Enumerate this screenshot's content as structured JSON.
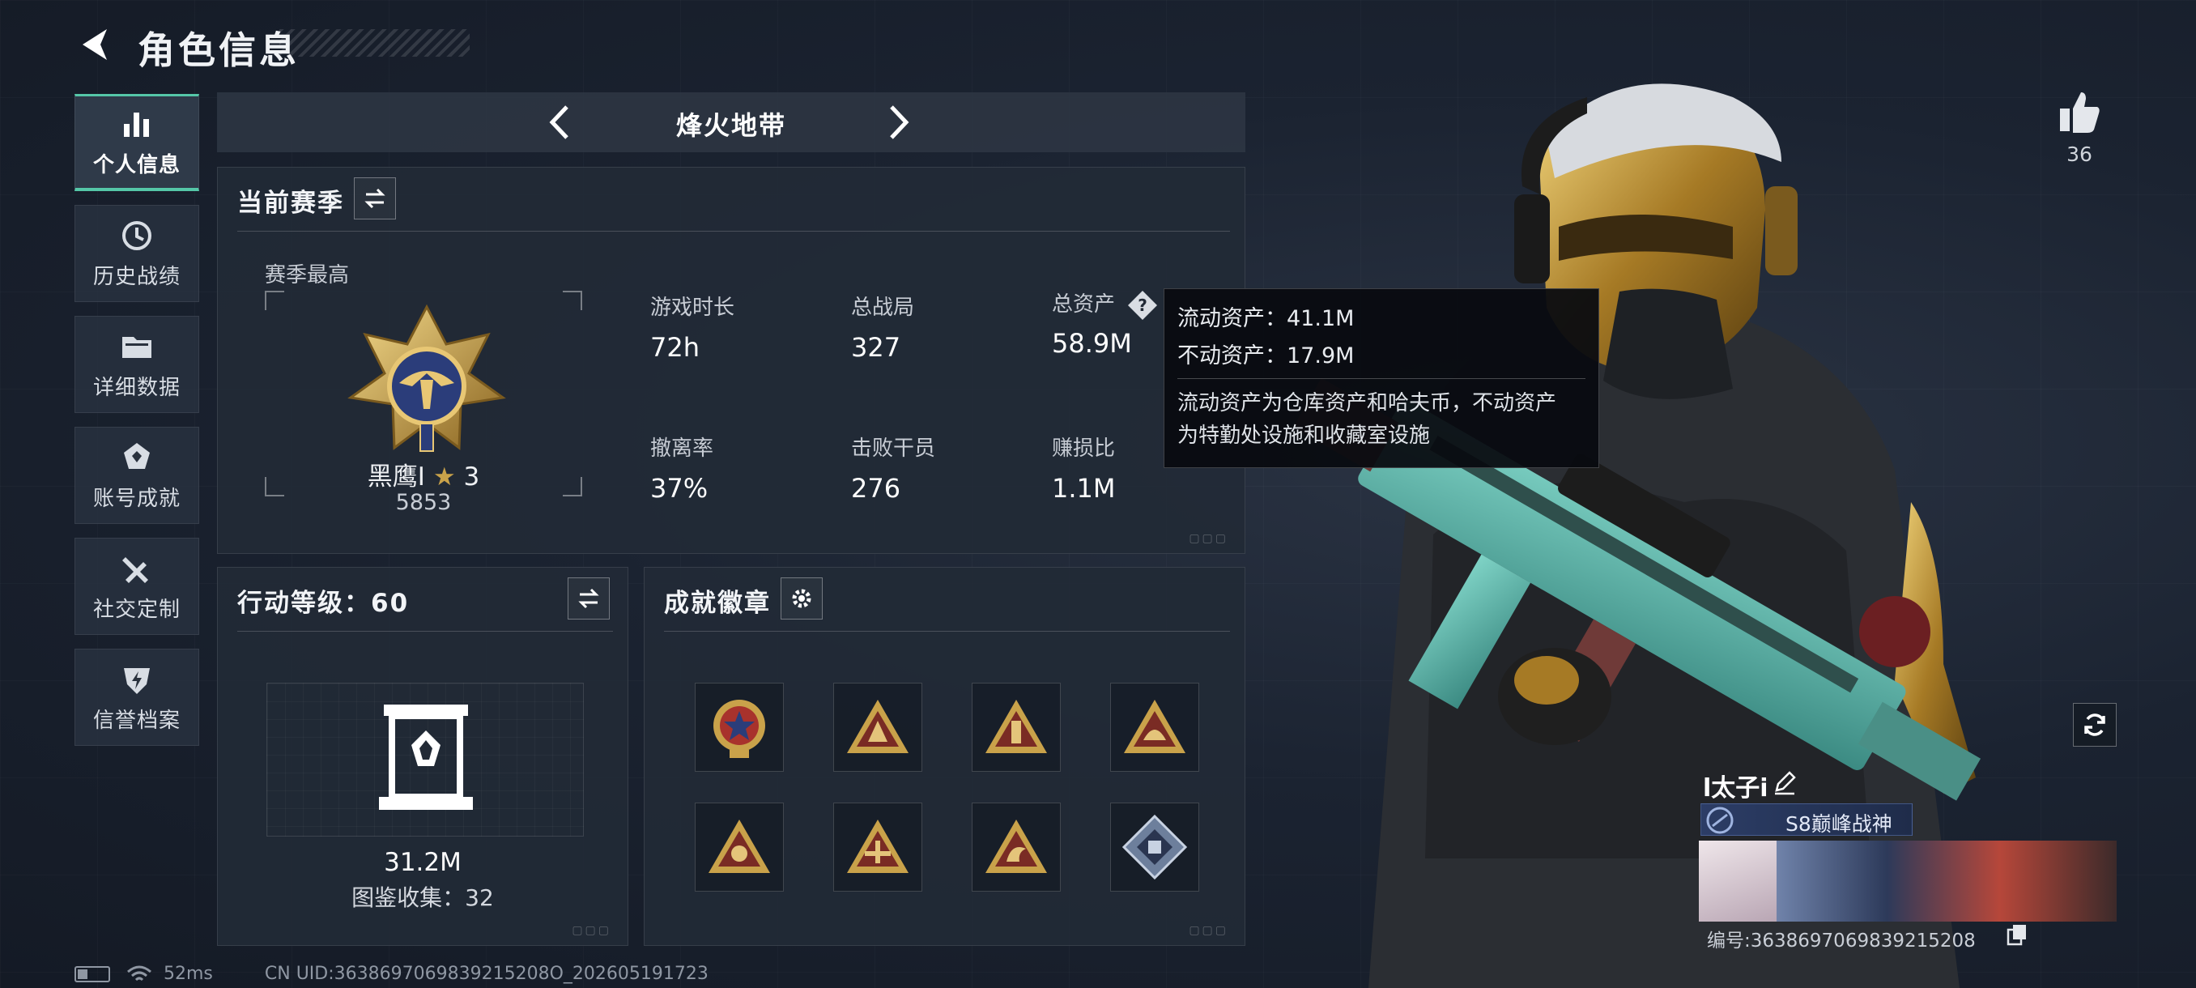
{
  "header": {
    "title": "角色信息"
  },
  "sidebar": {
    "items": [
      {
        "label": "个人信息",
        "icon": "bar-chart-icon"
      },
      {
        "label": "历史战绩",
        "icon": "history-icon"
      },
      {
        "label": "详细数据",
        "icon": "folder-icon"
      },
      {
        "label": "账号成就",
        "icon": "achievement-icon"
      },
      {
        "label": "社交定制",
        "icon": "tools-icon"
      },
      {
        "label": "信誉档案",
        "icon": "shield-icon"
      }
    ],
    "active_index": 0
  },
  "mode": {
    "title": "烽火地带"
  },
  "season": {
    "heading": "当前赛季",
    "sub_label": "赛季最高",
    "rank_name": "黑鹰I",
    "rank_stars": "3",
    "rank_score": "5853",
    "stats": [
      {
        "label": "游戏时长",
        "value": "72h"
      },
      {
        "label": "总战局",
        "value": "327"
      },
      {
        "label": "总资产",
        "value": "58.9M"
      },
      {
        "label": "撤离率",
        "value": "37%"
      },
      {
        "label": "击败干员",
        "value": "276"
      },
      {
        "label": "赚损比",
        "value": "1.1M"
      }
    ]
  },
  "tooltip": {
    "liquid": "流动资产：41.1M",
    "fixed": "不动资产：17.9M",
    "note_line1": "流动资产为仓库资产和哈夫币，不动资产",
    "note_line2": "为特勤处设施和收藏室设施"
  },
  "level": {
    "heading": "行动等级：60",
    "value": "31.2M",
    "collection": "图鉴收集：32"
  },
  "badges": {
    "heading": "成就徽章",
    "items": [
      "star-medal-icon",
      "triangle-badge-icon",
      "triangle-badge-icon",
      "triangle-badge-icon",
      "triangle-badge-icon",
      "triangle-badge-icon",
      "triangle-badge-icon",
      "diamond-badge-icon"
    ]
  },
  "profile": {
    "likes": "36",
    "name": "l太子i",
    "title": "S8巅峰战神",
    "uid_line": "编号:3638697069839215208"
  },
  "footer": {
    "ping": "52ms",
    "uid": "CN UID:3638697069839215208O_202605191723"
  },
  "colors": {
    "accent": "#55c7a8",
    "gold": "#c9a24a",
    "panel": "#222a36"
  }
}
